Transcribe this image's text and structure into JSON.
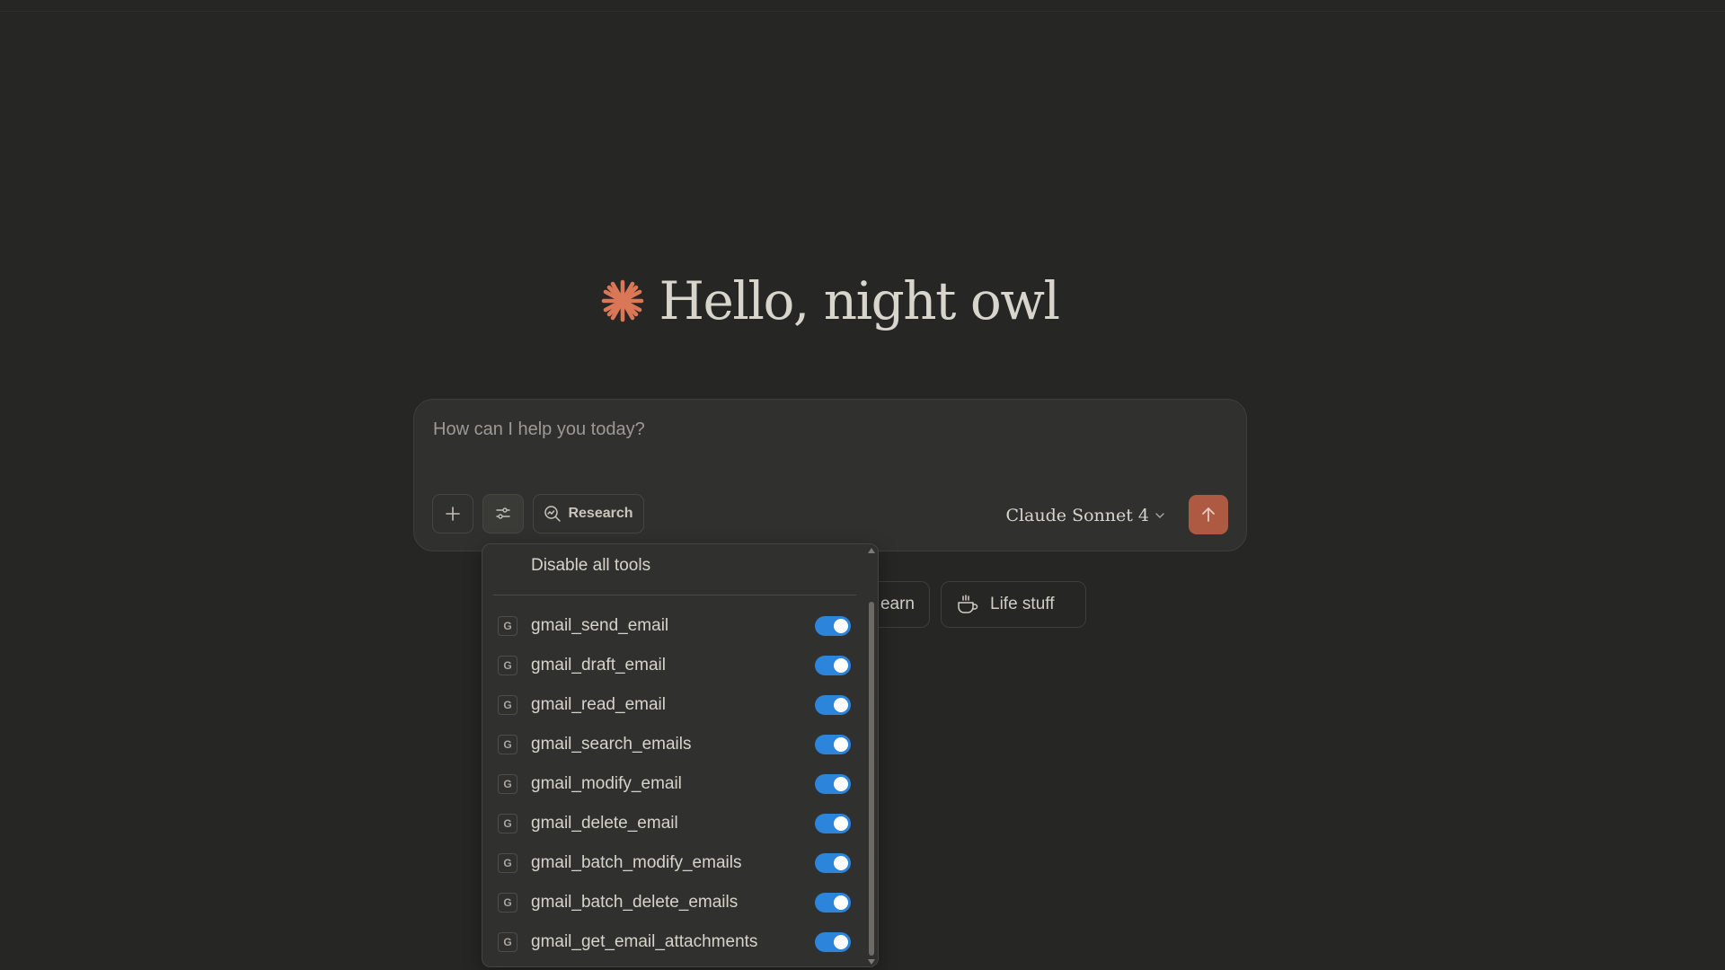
{
  "greeting": {
    "text": "Hello, night owl",
    "icon": "claude-star-icon"
  },
  "composer": {
    "placeholder": "How can I help you today?",
    "add_icon": "plus-icon",
    "tools_icon": "sliders-icon",
    "research_label": "Research",
    "research_icon": "research-search-icon",
    "model_label": "Claude Sonnet 4",
    "send_icon": "arrow-up-icon"
  },
  "chips": [
    {
      "label": "earn",
      "icon": ""
    },
    {
      "label": "Life stuff",
      "icon": "coffee-cup-icon"
    }
  ],
  "tools_menu": {
    "header": "Disable all tools",
    "items": [
      {
        "badge": "G",
        "name": "gmail_send_email",
        "enabled": true
      },
      {
        "badge": "G",
        "name": "gmail_draft_email",
        "enabled": true
      },
      {
        "badge": "G",
        "name": "gmail_read_email",
        "enabled": true
      },
      {
        "badge": "G",
        "name": "gmail_search_emails",
        "enabled": true
      },
      {
        "badge": "G",
        "name": "gmail_modify_email",
        "enabled": true
      },
      {
        "badge": "G",
        "name": "gmail_delete_email",
        "enabled": true
      },
      {
        "badge": "G",
        "name": "gmail_batch_modify_emails",
        "enabled": true
      },
      {
        "badge": "G",
        "name": "gmail_batch_delete_emails",
        "enabled": true
      },
      {
        "badge": "G",
        "name": "gmail_get_email_attachments",
        "enabled": true
      }
    ]
  },
  "colors": {
    "background": "#262624",
    "accent_orange": "#d97757",
    "send_button": "#ae5a42",
    "toggle_on": "#2c84db"
  }
}
